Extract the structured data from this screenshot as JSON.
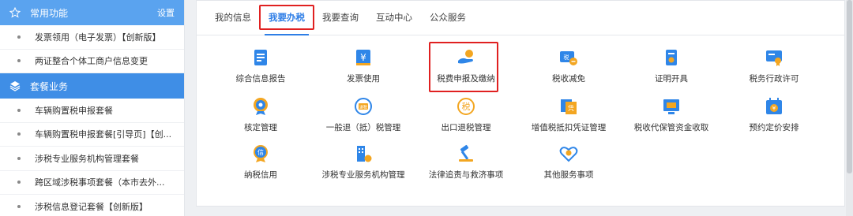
{
  "sidebar": {
    "header1": {
      "title": "常用功能",
      "setting": "设置"
    },
    "items1": [
      "发票领用（电子发票）【创新版】",
      "两证整合个体工商户信息变更"
    ],
    "header2": {
      "title": "套餐业务"
    },
    "items2": [
      "车辆购置税申报套餐",
      "车辆购置税申报套餐[引导页]【创...",
      "涉税专业服务机构管理套餐",
      "跨区域涉税事项套餐（本市去外...",
      "涉税信息登记套餐【创新版】"
    ]
  },
  "tabs": [
    {
      "label": "我的信息"
    },
    {
      "label": "我要办税"
    },
    {
      "label": "我要查询"
    },
    {
      "label": "互动中心"
    },
    {
      "label": "公众服务"
    }
  ],
  "functions": [
    {
      "label": "综合信息报告",
      "icon": "report-icon"
    },
    {
      "label": "发票使用",
      "icon": "invoice-icon"
    },
    {
      "label": "税费申报及缴纳",
      "icon": "tax-payment-icon"
    },
    {
      "label": "税收减免",
      "icon": "tax-reduction-icon"
    },
    {
      "label": "证明开具",
      "icon": "certificate-icon"
    },
    {
      "label": "税务行政许可",
      "icon": "license-icon"
    },
    {
      "label": "核定管理",
      "icon": "verification-icon"
    },
    {
      "label": "一般退（抵）税管理",
      "icon": "refund-icon"
    },
    {
      "label": "出口退税管理",
      "icon": "export-refund-icon"
    },
    {
      "label": "增值税抵扣凭证管理",
      "icon": "vat-voucher-icon"
    },
    {
      "label": "税收代保管资金收取",
      "icon": "custody-funds-icon"
    },
    {
      "label": "预约定价安排",
      "icon": "calendar-icon"
    },
    {
      "label": "纳税信用",
      "icon": "credit-icon"
    },
    {
      "label": "涉税专业服务机构管理",
      "icon": "agency-icon"
    },
    {
      "label": "法律追责与救济事项",
      "icon": "gavel-icon"
    },
    {
      "label": "其他服务事项",
      "icon": "heart-service-icon"
    }
  ],
  "colors": {
    "accent": "#2e7ee6",
    "highlight": "#e02020",
    "sidebar_header": "#5aa3ef"
  }
}
